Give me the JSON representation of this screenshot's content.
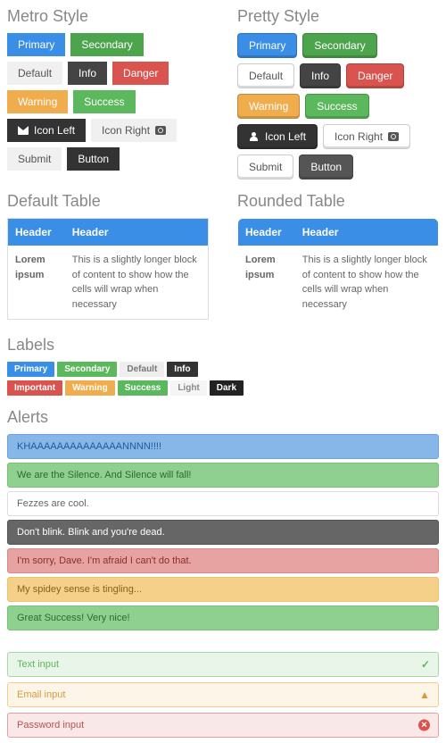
{
  "sections": {
    "metro_title": "Metro Style",
    "pretty_title": "Pretty Style",
    "default_table_title": "Default Table",
    "rounded_table_title": "Rounded Table",
    "labels_title": "Labels",
    "alerts_title": "Alerts"
  },
  "buttons": {
    "primary": "Primary",
    "secondary": "Secondary",
    "default": "Default",
    "info": "Info",
    "danger": "Danger",
    "warning": "Warning",
    "success": "Success",
    "icon_left": "Icon Left",
    "icon_right": "Icon Right",
    "submit": "Submit",
    "button": "Button"
  },
  "table": {
    "header1": "Header",
    "header2": "Header",
    "cell1": "Lorem ipsum",
    "cell2": "This is a slightly longer block of content to show how the cells will wrap when necessary"
  },
  "labels": {
    "primary": "Primary",
    "secondary": "Secondary",
    "default": "Default",
    "info": "Info",
    "important": "Important",
    "warning": "Warning",
    "success": "Success",
    "light": "Light",
    "dark": "Dark"
  },
  "alerts": {
    "primary": "KHAAAAAAAAAAAAAANNNN!!!!",
    "secondary": "We are the Silence. And Silence will fall!",
    "default": "Fezzes are cool.",
    "info": "Don't blink. Blink and you're dead.",
    "danger": "I'm sorry, Dave. I'm afraid I can't do that.",
    "warning": "My spidey sense is tingling...",
    "success": "Great Success! Very nice!"
  },
  "inputs": {
    "text_placeholder": "Text input",
    "email_placeholder": "Email input",
    "password_placeholder": "Password input"
  }
}
